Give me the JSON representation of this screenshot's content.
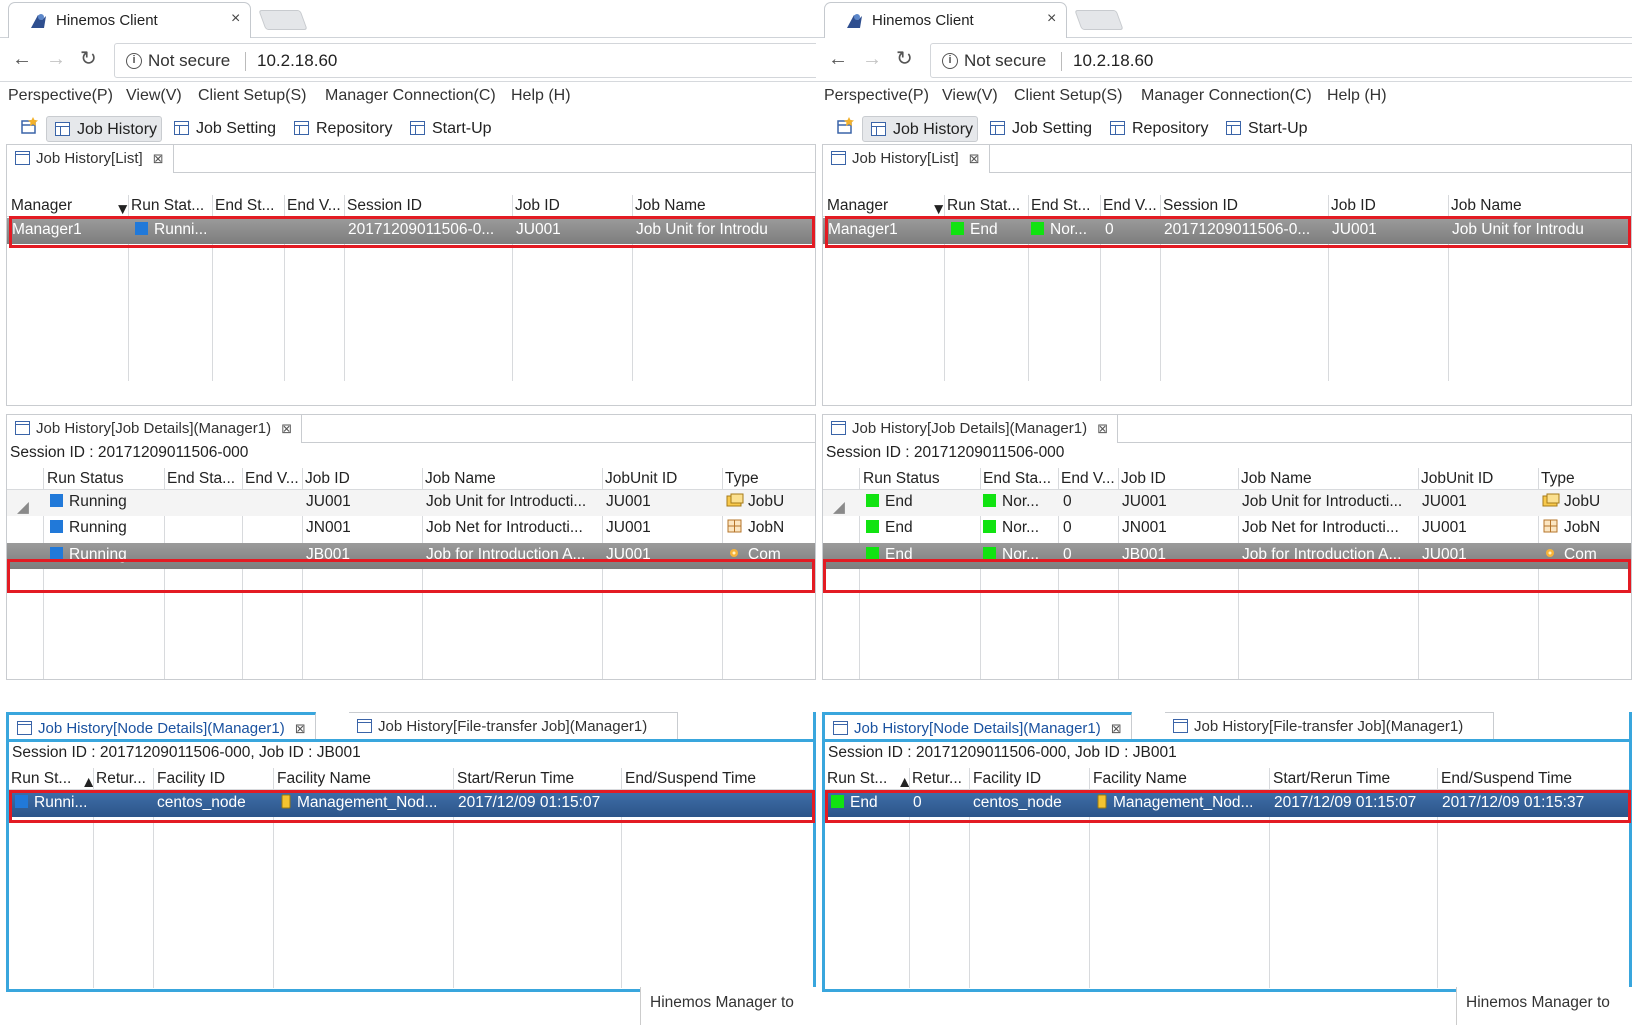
{
  "colors": {
    "highlight": "#e31b23",
    "running": "#2179d9",
    "end": "#11e311",
    "selected_gray": "#8c8c8c",
    "selected_blue": "#2f5d96",
    "view_border": "#39a6dd"
  },
  "panels": [
    {
      "tab_title": "Hinemos Client",
      "tab_close": "×",
      "not_secure": "Not secure",
      "url": "10.2.18.60",
      "menu": [
        "Perspective(P)",
        "View(V)",
        "Client Setup(S)",
        "Manager Connection(C)",
        "Help (H)"
      ],
      "toolbar": [
        "Job History",
        "Job Setting",
        "Repository",
        "Start-Up"
      ],
      "list_view": {
        "title": "Job History[List]",
        "headers": [
          "Manager",
          "Run Stat...",
          "End St...",
          "End V...",
          "Session ID",
          "Job ID",
          "Job Name"
        ],
        "row": {
          "manager": "Manager1",
          "run": "Runni...",
          "run_status": "running",
          "end": "",
          "end_status": "",
          "endv": "",
          "session": "20171209011506-0...",
          "jobid": "JU001",
          "jobname": "Job Unit for Introdu"
        }
      },
      "details_view": {
        "title": "Job History[Job Details](Manager1)",
        "session_line": "Session ID : 20171209011506-000",
        "headers": [
          "Run Status",
          "End Sta...",
          "End V...",
          "Job ID",
          "Job Name",
          "JobUnit ID",
          "Type"
        ],
        "rows": [
          {
            "run": "Running",
            "run_status": "running",
            "end": "",
            "end_status": "",
            "endv": "",
            "jobid": "JU001",
            "jobname": "Job Unit for Introducti...",
            "unit": "JU001",
            "type": "JobU",
            "type_icon": "jobunit-icon"
          },
          {
            "run": "Running",
            "run_status": "running",
            "end": "",
            "end_status": "",
            "endv": "",
            "jobid": "JN001",
            "jobname": "Job Net for Introducti...",
            "unit": "JU001",
            "type": "JobN",
            "type_icon": "jobnet-icon"
          },
          {
            "run": "Running",
            "run_status": "running",
            "end": "",
            "end_status": "",
            "endv": "",
            "jobid": "JB001",
            "jobname": "Job for Introduction A...",
            "unit": "JU001",
            "type": "Com",
            "type_icon": "command-job-icon"
          }
        ]
      },
      "node_view": {
        "title": "Job History[Node Details](Manager1)",
        "second_tab": "Job History[File-transfer Job](Manager1)",
        "session_line": "Session ID : 20171209011506-000,   Job ID : JB001",
        "headers": [
          "Run St...",
          "Retur...",
          "Facility ID",
          "Facility Name",
          "Start/Rerun Time",
          "End/Suspend Time"
        ],
        "row": {
          "run": "Runni...",
          "run_status": "running",
          "ret": "",
          "fid": "centos_node",
          "fname": "Management_Nod...",
          "start": "2017/12/09 01:15:07",
          "end": ""
        }
      },
      "status_text": "Hinemos Manager to"
    },
    {
      "tab_title": "Hinemos Client",
      "tab_close": "×",
      "not_secure": "Not secure",
      "url": "10.2.18.60",
      "menu": [
        "Perspective(P)",
        "View(V)",
        "Client Setup(S)",
        "Manager Connection(C)",
        "Help (H)"
      ],
      "toolbar": [
        "Job History",
        "Job Setting",
        "Repository",
        "Start-Up"
      ],
      "list_view": {
        "title": "Job History[List]",
        "headers": [
          "Manager",
          "Run Stat...",
          "End St...",
          "End V...",
          "Session ID",
          "Job ID",
          "Job Name"
        ],
        "row": {
          "manager": "Manager1",
          "run": "End",
          "run_status": "end",
          "end": "Nor...",
          "end_status": "end",
          "endv": "0",
          "session": "20171209011506-0...",
          "jobid": "JU001",
          "jobname": "Job Unit for Introdu"
        }
      },
      "details_view": {
        "title": "Job History[Job Details](Manager1)",
        "session_line": "Session ID : 20171209011506-000",
        "headers": [
          "Run Status",
          "End Sta...",
          "End V...",
          "Job ID",
          "Job Name",
          "JobUnit ID",
          "Type"
        ],
        "rows": [
          {
            "run": "End",
            "run_status": "end",
            "end": "Nor...",
            "end_status": "end",
            "endv": "0",
            "jobid": "JU001",
            "jobname": "Job Unit for Introducti...",
            "unit": "JU001",
            "type": "JobU",
            "type_icon": "jobunit-icon"
          },
          {
            "run": "End",
            "run_status": "end",
            "end": "Nor...",
            "end_status": "end",
            "endv": "0",
            "jobid": "JN001",
            "jobname": "Job Net for Introducti...",
            "unit": "JU001",
            "type": "JobN",
            "type_icon": "jobnet-icon"
          },
          {
            "run": "End",
            "run_status": "end",
            "end": "Nor...",
            "end_status": "end",
            "endv": "0",
            "jobid": "JB001",
            "jobname": "Job for Introduction A...",
            "unit": "JU001",
            "type": "Com",
            "type_icon": "command-job-icon"
          }
        ]
      },
      "node_view": {
        "title": "Job History[Node Details](Manager1)",
        "second_tab": "Job History[File-transfer Job](Manager1)",
        "session_line": "Session ID : 20171209011506-000,   Job ID : JB001",
        "headers": [
          "Run St...",
          "Retur...",
          "Facility ID",
          "Facility Name",
          "Start/Rerun Time",
          "End/Suspend Time"
        ],
        "row": {
          "run": "End",
          "run_status": "end",
          "ret": "0",
          "fid": "centos_node",
          "fname": "Management_Nod...",
          "start": "2017/12/09 01:15:07",
          "end": "2017/12/09 01:15:37"
        }
      },
      "status_text": "Hinemos Manager to"
    }
  ]
}
